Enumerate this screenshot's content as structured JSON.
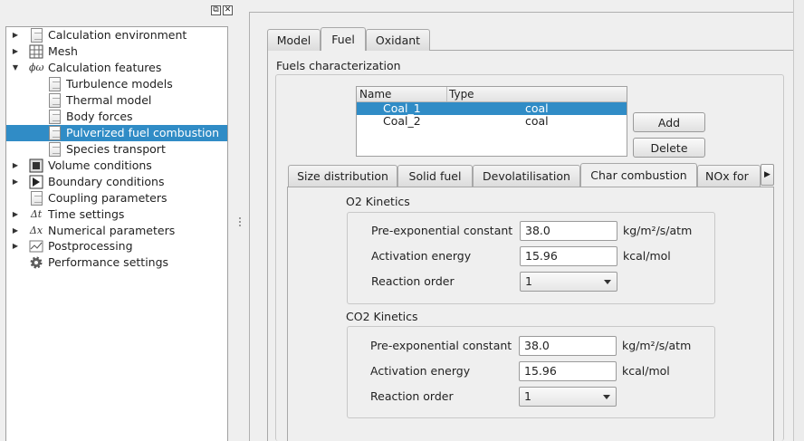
{
  "dock": {
    "float_btn": "⧉",
    "close_btn": "✕"
  },
  "tree": [
    {
      "label": "Calculation environment",
      "icon": "document-icon",
      "expand": "collapsed"
    },
    {
      "label": "Mesh",
      "icon": "mesh-icon",
      "expand": "collapsed"
    },
    {
      "label": "Calculation features",
      "icon": "phi-omega-icon",
      "icon_text": "ϕω",
      "expand": "expanded"
    },
    {
      "label": "Turbulence models",
      "icon": "document-icon",
      "expand": "none"
    },
    {
      "label": "Thermal model",
      "icon": "document-icon",
      "expand": "none"
    },
    {
      "label": "Body forces",
      "icon": "document-icon",
      "expand": "none"
    },
    {
      "label": "Pulverized fuel combustion",
      "icon": "document-icon",
      "expand": "none",
      "selected": true
    },
    {
      "label": "Species transport",
      "icon": "document-icon",
      "expand": "none"
    },
    {
      "label": "Volume conditions",
      "icon": "volume-icon",
      "expand": "collapsed"
    },
    {
      "label": "Boundary conditions",
      "icon": "boundary-icon",
      "expand": "collapsed"
    },
    {
      "label": "Coupling parameters",
      "icon": "document-icon",
      "expand": "none"
    },
    {
      "label": "Time settings",
      "icon": "delta-t-icon",
      "icon_text": "Δt",
      "expand": "collapsed"
    },
    {
      "label": "Numerical parameters",
      "icon": "delta-x-icon",
      "icon_text": "Δx",
      "expand": "collapsed"
    },
    {
      "label": "Postprocessing",
      "icon": "chart-icon",
      "expand": "collapsed"
    },
    {
      "label": "Performance settings",
      "icon": "gear-icon",
      "expand": "none"
    }
  ],
  "top_tabs": [
    "Model",
    "Fuel",
    "Oxidant"
  ],
  "fuels": {
    "title": "Fuels characterization",
    "columns": [
      "Name",
      "Type"
    ],
    "rows": [
      {
        "name": "Coal_1",
        "type": "coal",
        "selected": true
      },
      {
        "name": "Coal_2",
        "type": "coal",
        "selected": false
      }
    ],
    "add_label": "Add",
    "delete_label": "Delete"
  },
  "sub_tabs": [
    "Size distribution",
    "Solid fuel",
    "Devolatilisation",
    "Char combustion",
    "NOx for"
  ],
  "o2": {
    "title": "O2 Kinetics",
    "pre_exp_label": "Pre-exponential constant",
    "pre_exp_value": "38.0",
    "pre_exp_unit": "kg/m²/s/atm",
    "act_label": "Activation energy",
    "act_value": "15.96",
    "act_unit": "kcal/mol",
    "order_label": "Reaction order",
    "order_value": "1"
  },
  "co2": {
    "title": "CO2 Kinetics",
    "pre_exp_label": "Pre-exponential constant",
    "pre_exp_value": "38.0",
    "pre_exp_unit": "kg/m²/s/atm",
    "act_label": "Activation energy",
    "act_value": "15.96",
    "act_unit": "kcal/mol",
    "order_label": "Reaction order",
    "order_value": "1"
  },
  "colors": {
    "selection": "#308cc6"
  }
}
